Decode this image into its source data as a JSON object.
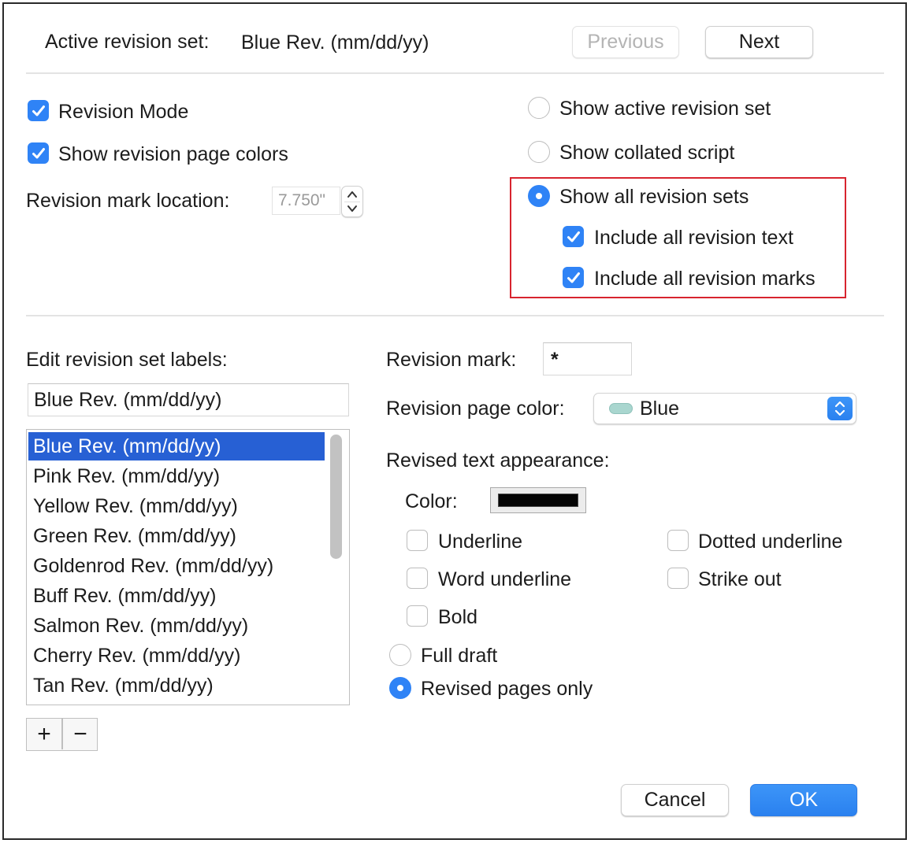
{
  "header": {
    "active_label": "Active revision set:",
    "active_value": "Blue Rev. (mm/dd/yy)",
    "previous_label": "Previous",
    "next_label": "Next"
  },
  "options": {
    "revision_mode": {
      "label": "Revision Mode",
      "checked": true
    },
    "show_page_colors": {
      "label": "Show revision page colors",
      "checked": true
    },
    "mark_location_label": "Revision mark location:",
    "mark_location_value": "7.750\""
  },
  "view": {
    "show_active": "Show active revision set",
    "show_collated": "Show collated script",
    "show_all": "Show all revision sets",
    "include_text": "Include all revision text",
    "include_marks": "Include all revision marks",
    "selected": "show_all"
  },
  "labels": {
    "title": "Edit revision set labels:",
    "edit_value": "Blue Rev. (mm/dd/yy)",
    "items": [
      "Blue Rev. (mm/dd/yy)",
      "Pink Rev. (mm/dd/yy)",
      "Yellow Rev. (mm/dd/yy)",
      "Green Rev. (mm/dd/yy)",
      "Goldenrod Rev. (mm/dd/yy)",
      "Buff Rev. (mm/dd/yy)",
      "Salmon Rev. (mm/dd/yy)",
      "Cherry Rev. (mm/dd/yy)",
      "Tan Rev. (mm/dd/yy)"
    ],
    "selected_index": 0,
    "add_label": "+",
    "remove_label": "−"
  },
  "mark": {
    "revision_mark_label": "Revision mark:",
    "revision_mark_value": "*",
    "page_color_label": "Revision page color:",
    "page_color_value": "Blue",
    "page_color_swatch": "#a9d6cf"
  },
  "appearance": {
    "title": "Revised text appearance:",
    "color_label": "Color:",
    "color_value": "#000000",
    "underline": "Underline",
    "dotted_underline": "Dotted underline",
    "word_underline": "Word underline",
    "strike_out": "Strike out",
    "bold": "Bold"
  },
  "print": {
    "full_draft": "Full draft",
    "revised_only": "Revised pages only",
    "selected": "revised_only"
  },
  "footer": {
    "cancel_label": "Cancel",
    "ok_label": "OK"
  },
  "colors": {
    "accent": "#2f83f6",
    "selection": "#2760d4",
    "highlight_box": "#d8242f"
  }
}
